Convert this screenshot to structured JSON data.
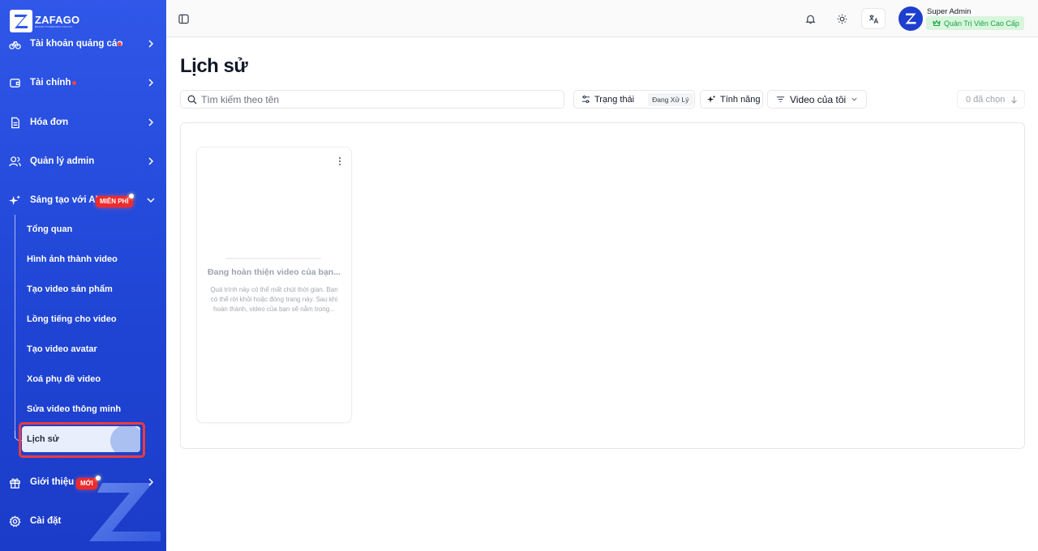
{
  "brand": {
    "name": "ZAFAGO",
    "tagline": "BRAND POWERING DIGITAL"
  },
  "sidebar": {
    "items": [
      {
        "label": "Tài khoản quảng cáo",
        "icon": "bicycle-icon"
      },
      {
        "label": "Tài chính",
        "icon": "wallet-icon"
      },
      {
        "label": "Hóa đơn",
        "icon": "invoice-icon"
      },
      {
        "label": "Quản lý admin",
        "icon": "users-icon"
      },
      {
        "label": "Sáng tạo với AI",
        "icon": "sparkles-icon",
        "badge": "MIỄN PHÍ"
      }
    ],
    "sub_items": [
      "Tổng quan",
      "Hình ảnh thành video",
      "Tạo video sản phẩm",
      "Lồng tiếng cho video",
      "Tạo video avatar",
      "Xoá phụ đề video",
      "Sửa video thông minh"
    ],
    "active_item": "Lịch sử",
    "bottom_items": [
      {
        "label": "Giới thiệu",
        "icon": "gift-icon",
        "badge": "MỚI"
      },
      {
        "label": "Cài đặt",
        "icon": "gear-icon"
      }
    ]
  },
  "header": {
    "user_name": "Super Admin",
    "user_role": "Quản Trị Viên Cao Cấp"
  },
  "main": {
    "title": "Lịch sử",
    "search_placeholder": "Tìm kiếm theo tên",
    "filters": {
      "status_label": "Trạng thái",
      "status_value": "Đang Xử Lý",
      "feature_label": "Tính năng",
      "owner_label": "Video của tôi",
      "selected_label": "0 đã chọn"
    },
    "card": {
      "title": "Đang hoàn thiện video của bạn...",
      "description": "Quá trình này có thể mất chút thời gian. Bạn có thể rời khỏi hoặc đóng trang này. Sau khi hoàn thành, video của bạn sẽ nằm trong..."
    }
  },
  "colors": {
    "sidebar": "#2f57e8",
    "accent_red": "#ef3b3b",
    "role_green": "#16a34a"
  }
}
